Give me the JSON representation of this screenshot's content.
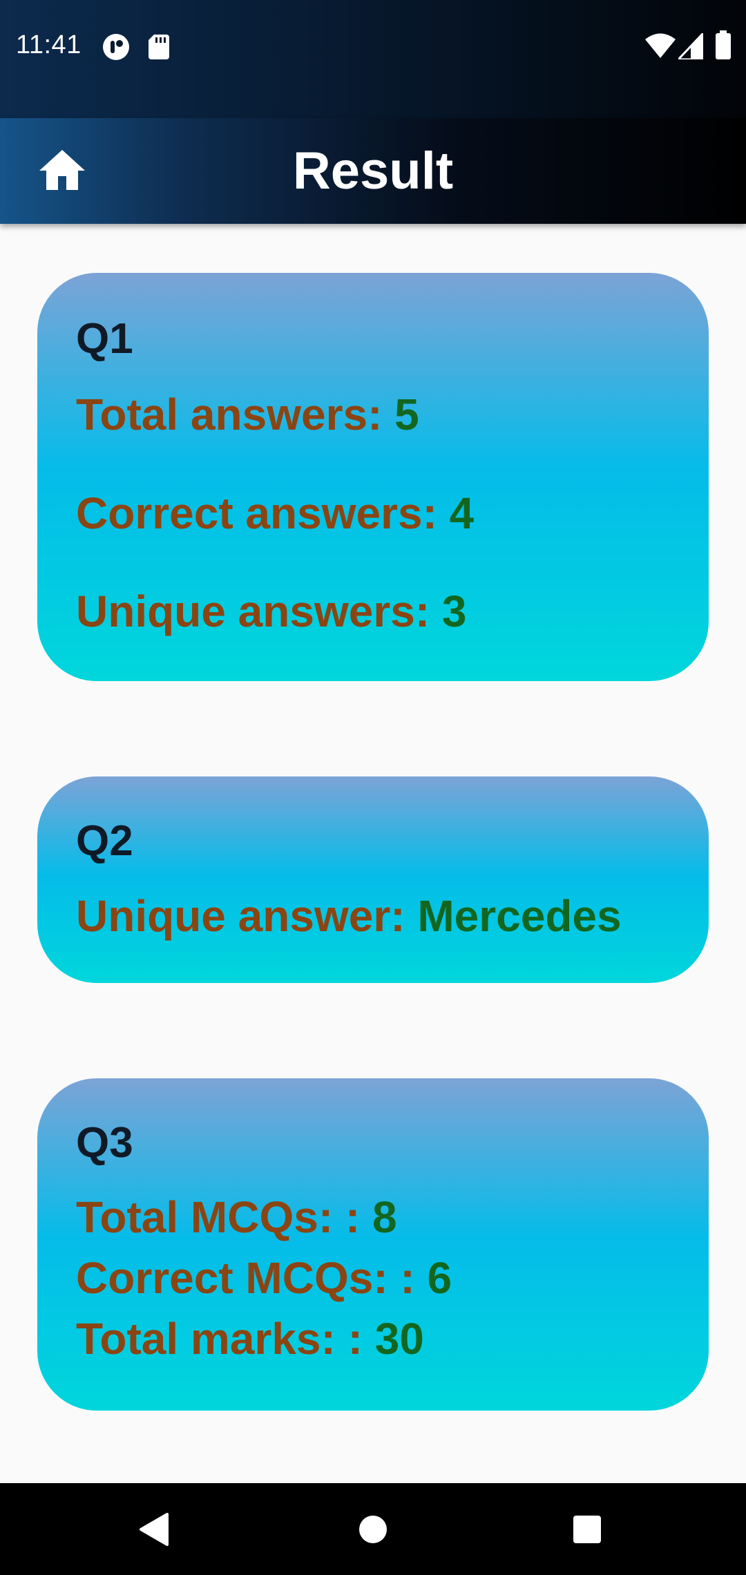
{
  "status_bar": {
    "time": "11:41",
    "icons": [
      "privacy-dot-icon",
      "sd-card-icon",
      "wifi-icon",
      "signal-icon",
      "battery-icon"
    ]
  },
  "app_bar": {
    "title": "Result",
    "home_icon": "home-icon"
  },
  "colors": {
    "label": "#8a4513",
    "value": "#12661f",
    "card_top": "#7ca3d6",
    "card_mid": "#05bce9",
    "card_bottom": "#00d6dc"
  },
  "cards": {
    "q1": {
      "title": "Q1",
      "total_label": "Total answers: ",
      "total_value": "5",
      "correct_label": "Correct answers: ",
      "correct_value": "4",
      "unique_label": "Unique answers: ",
      "unique_value": "3"
    },
    "q2": {
      "title": "Q2",
      "unique_label": "Unique answer: ",
      "unique_value": "Mercedes"
    },
    "q3": {
      "title": "Q3",
      "total_mcqs_label": "Total MCQs: : ",
      "total_mcqs_value": "8",
      "correct_mcqs_label": "Correct MCQs: : ",
      "correct_mcqs_value": "6",
      "total_marks_label": "Total marks: : ",
      "total_marks_value": "30"
    }
  },
  "nav_bar": {
    "icons": [
      "back-icon",
      "home-circle-icon",
      "recents-icon"
    ]
  }
}
